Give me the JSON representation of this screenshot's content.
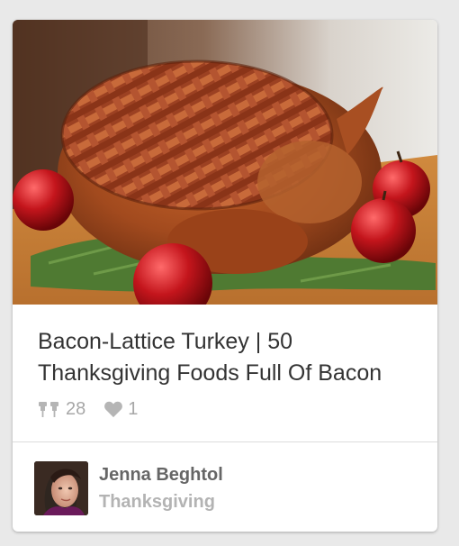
{
  "pin": {
    "image_description": "Roasted turkey wrapped in a woven bacon lattice on a bed of rosemary with red apples",
    "description": "Bacon-Lattice Turkey | 50 Thanksgiving Foods Full Of Bacon",
    "repin_count": "28",
    "like_count": "1"
  },
  "pinner": {
    "name": "Jenna Beghtol",
    "board": "Thanksgiving"
  },
  "icons": {
    "repin": "pushpin-icon",
    "like": "heart-icon"
  },
  "colors": {
    "background": "#e9e9e9",
    "card": "#ffffff",
    "text_primary": "#333333",
    "text_muted": "#a7a7a7",
    "pinner_name": "#666666",
    "board_name": "#b3b3b3"
  }
}
